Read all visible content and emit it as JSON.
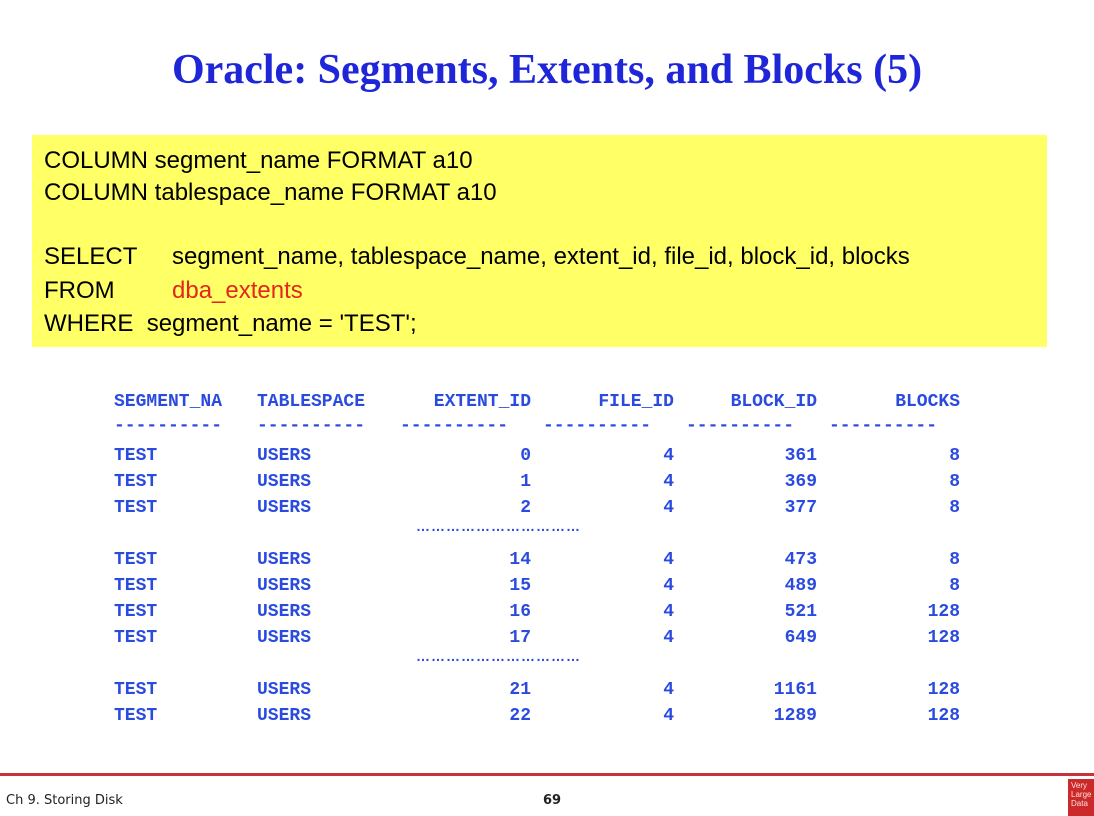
{
  "title": "Oracle: Segments, Extents, and Blocks (5)",
  "code": {
    "line1": "COLUMN segment_name FORMAT a10",
    "line2": "COLUMN tablespace_name FORMAT a10",
    "select_kw": "SELECT",
    "select_cols": "segment_name, tablespace_name, extent_id, file_id, block_id, blocks",
    "from_kw": "FROM",
    "from_table": "dba_extents",
    "where_kw": "WHERE",
    "where_clause": "segment_name = 'TEST';"
  },
  "result": {
    "headers": [
      "SEGMENT_NA",
      "TABLESPACE",
      "EXTENT_ID",
      "FILE_ID",
      "BLOCK_ID",
      "BLOCKS"
    ],
    "separator": "----------",
    "ellipsis": "……………………………",
    "rows_group1": [
      [
        "TEST",
        "USERS",
        "0",
        "4",
        "361",
        "8"
      ],
      [
        "TEST",
        "USERS",
        "1",
        "4",
        "369",
        "8"
      ],
      [
        "TEST",
        "USERS",
        "2",
        "4",
        "377",
        "8"
      ]
    ],
    "rows_group2": [
      [
        "TEST",
        "USERS",
        "14",
        "4",
        "473",
        "8"
      ],
      [
        "TEST",
        "USERS",
        "15",
        "4",
        "489",
        "8"
      ],
      [
        "TEST",
        "USERS",
        "16",
        "4",
        "521",
        "128"
      ],
      [
        "TEST",
        "USERS",
        "17",
        "4",
        "649",
        "128"
      ]
    ],
    "rows_group3": [
      [
        "TEST",
        "USERS",
        "21",
        "4",
        "1161",
        "128"
      ],
      [
        "TEST",
        "USERS",
        "22",
        "4",
        "1289",
        "128"
      ]
    ]
  },
  "footer": {
    "chapter": "Ch 9. Storing Disk",
    "page": "69",
    "logo_text": "Very Large Data"
  },
  "colors": {
    "title": "#1e26d8",
    "code_bg": "#ffff66",
    "highlight": "#e4261c",
    "result_text": "#2b4be0",
    "footer_rule": "#c9323a"
  }
}
